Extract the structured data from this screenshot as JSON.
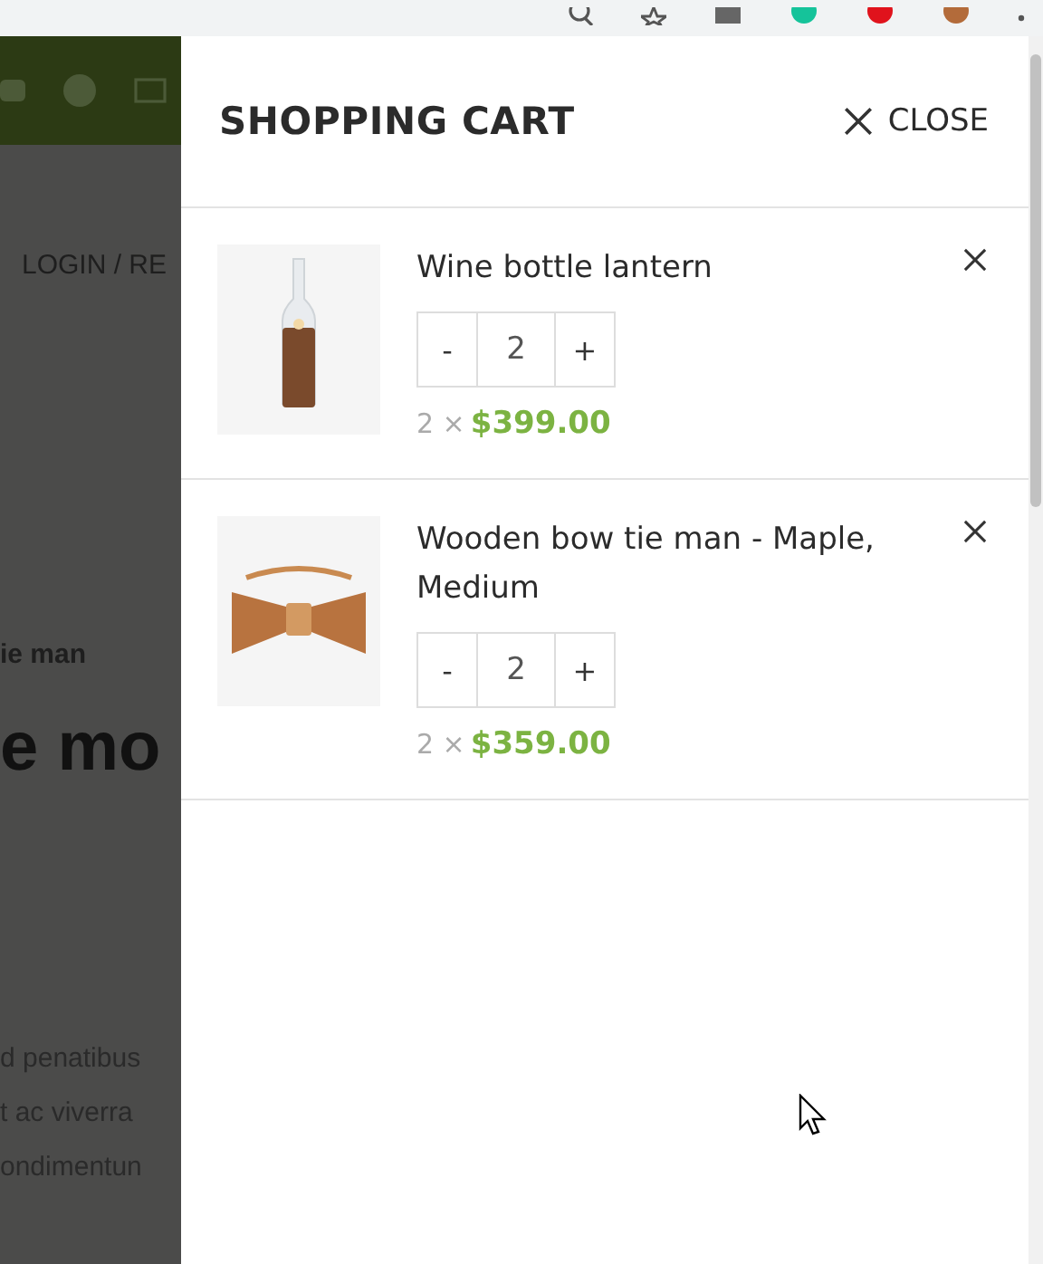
{
  "background_page": {
    "nav_link": "LOGIN / RE",
    "breadcrumb": "ie man",
    "heading": "e mo",
    "paragraph_lines": [
      "d penatibus",
      "t ac viverra",
      "ondimentun"
    ]
  },
  "cart": {
    "title": "SHOPPING CART",
    "close_label": "CLOSE",
    "items": [
      {
        "name": "Wine bottle lantern",
        "decrease": "-",
        "quantity": "2",
        "increase": "+",
        "multiplier": "2 ×",
        "price": "$399.00"
      },
      {
        "name": "Wooden bow tie man - Maple, Medium",
        "decrease": "-",
        "quantity": "2",
        "increase": "+",
        "multiplier": "2 ×",
        "price": "$359.00"
      }
    ]
  }
}
